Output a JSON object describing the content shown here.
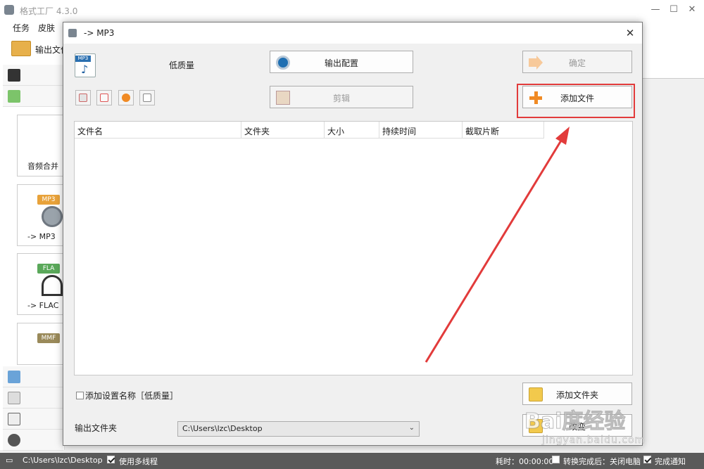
{
  "main_window": {
    "title": "格式工厂 4.3.0",
    "menu": [
      "任务",
      "皮肤"
    ],
    "toolbar": {
      "output_folder_label": "输出文件"
    },
    "tiles": [
      {
        "label": "音频合并",
        "badge": ""
      },
      {
        "label": "-> MP3",
        "badge": "MP3"
      },
      {
        "label": "-> FLAC",
        "badge": "FLA"
      },
      {
        "label": "",
        "badge": "MMF"
      }
    ]
  },
  "statusbar": {
    "path": "C:\\Users\\lzc\\Desktop",
    "multithread_label": "使用多线程",
    "multithread_checked": true,
    "elapsed": "耗时：00:00:00",
    "after_convert_label": "转换完成后：关闭电脑",
    "after_convert_checked": false,
    "notify_label": "完成通知",
    "notify_checked": true
  },
  "dialog": {
    "title": "-> MP3",
    "quality": "低质量",
    "buttons": {
      "output_config": "输出配置",
      "ok": "确定",
      "clip": "剪辑",
      "add_file": "添加文件",
      "add_folder": "添加文件夹",
      "change": "改变"
    },
    "columns": [
      "文件名",
      "文件夹",
      "大小",
      "持续时间",
      "截取片断"
    ],
    "add_setting_name_label": "添加设置名称［低质量］",
    "add_setting_name_checked": false,
    "output_folder_label": "输出文件夹",
    "output_folder_value": "C:\\Users\\lzc\\Desktop"
  },
  "annotation": {
    "color": "#e23b3b"
  },
  "watermark": {
    "text": "Bai度经验",
    "sub": "jingyan.baidu.com"
  },
  "colors": {
    "accent_orange": "#f08a24",
    "statusbar_bg": "#5a5a5a"
  }
}
